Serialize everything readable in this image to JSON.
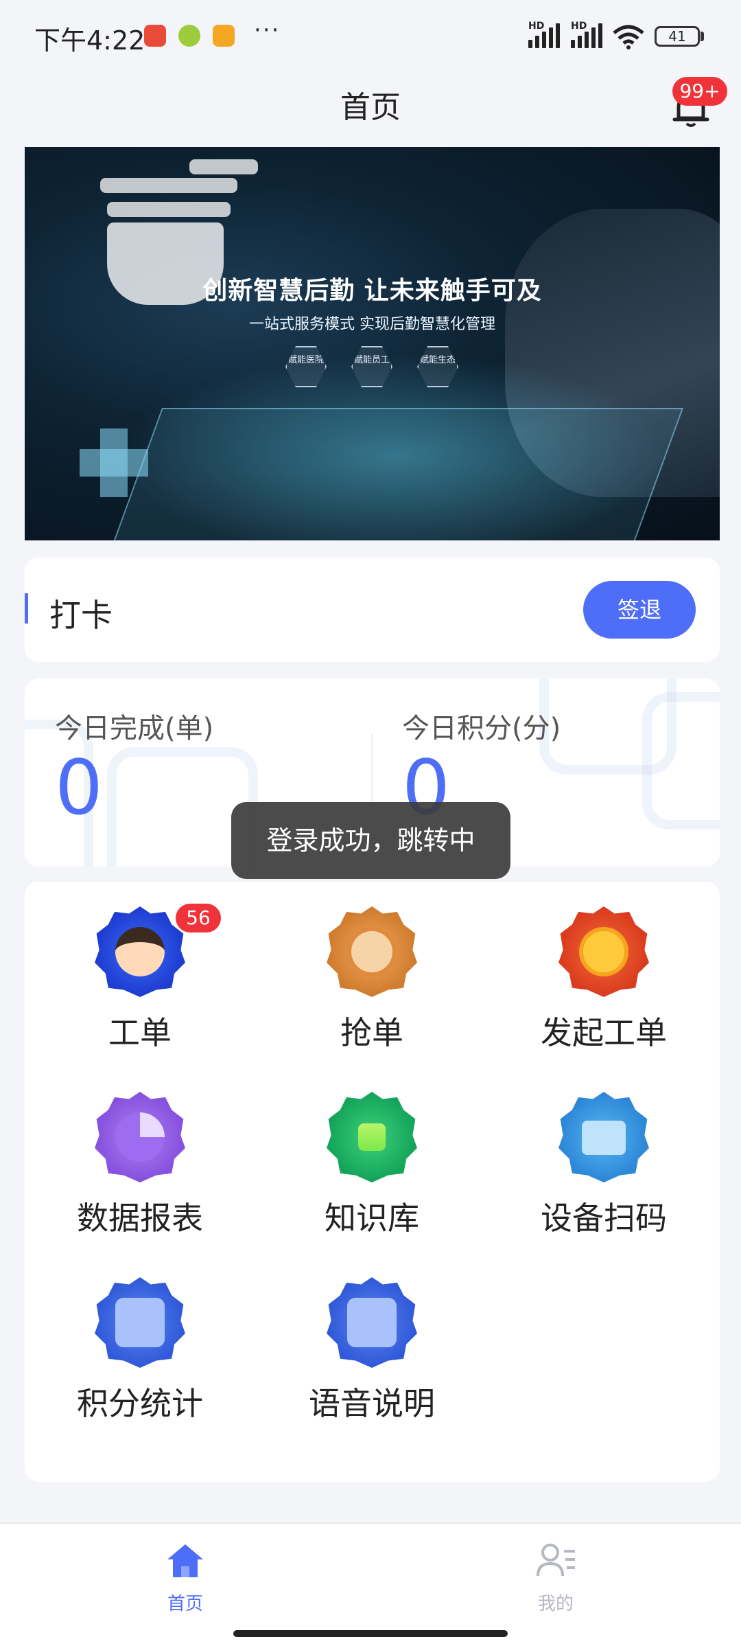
{
  "status_bar": {
    "time": "下午4:22",
    "more": "···",
    "hd1": "HD",
    "hd2": "HD",
    "battery": "41"
  },
  "header": {
    "title": "首页",
    "notification_badge": "99+"
  },
  "banner": {
    "title": "创新智慧后勤  让未来触手可及",
    "subtitle": "一站式服务模式  实现后勤智慧化管理",
    "hex_labels": [
      "赋能医院",
      "赋能员工",
      "赋能生态"
    ]
  },
  "punch": {
    "title": "打卡",
    "button": "签退"
  },
  "stats": {
    "completed_label": "今日完成(单)",
    "completed_value": "0",
    "points_label": "今日积分(分)",
    "points_value": "0"
  },
  "toast": {
    "message": "登录成功，跳转中"
  },
  "menu": {
    "items": [
      {
        "label": "工单",
        "badge": "56"
      },
      {
        "label": "抢单"
      },
      {
        "label": "发起工单"
      },
      {
        "label": "数据报表"
      },
      {
        "label": "知识库"
      },
      {
        "label": "设备扫码"
      },
      {
        "label": "积分统计"
      },
      {
        "label": "语音说明"
      }
    ]
  },
  "tabs": [
    {
      "label": "首页",
      "active": true,
      "icon": "home-icon"
    },
    {
      "label": "我的",
      "active": false,
      "icon": "profile-icon"
    }
  ],
  "colors": {
    "accent": "#4f6ef7",
    "badge": "#f0333a",
    "background": "#f4f5f8"
  }
}
